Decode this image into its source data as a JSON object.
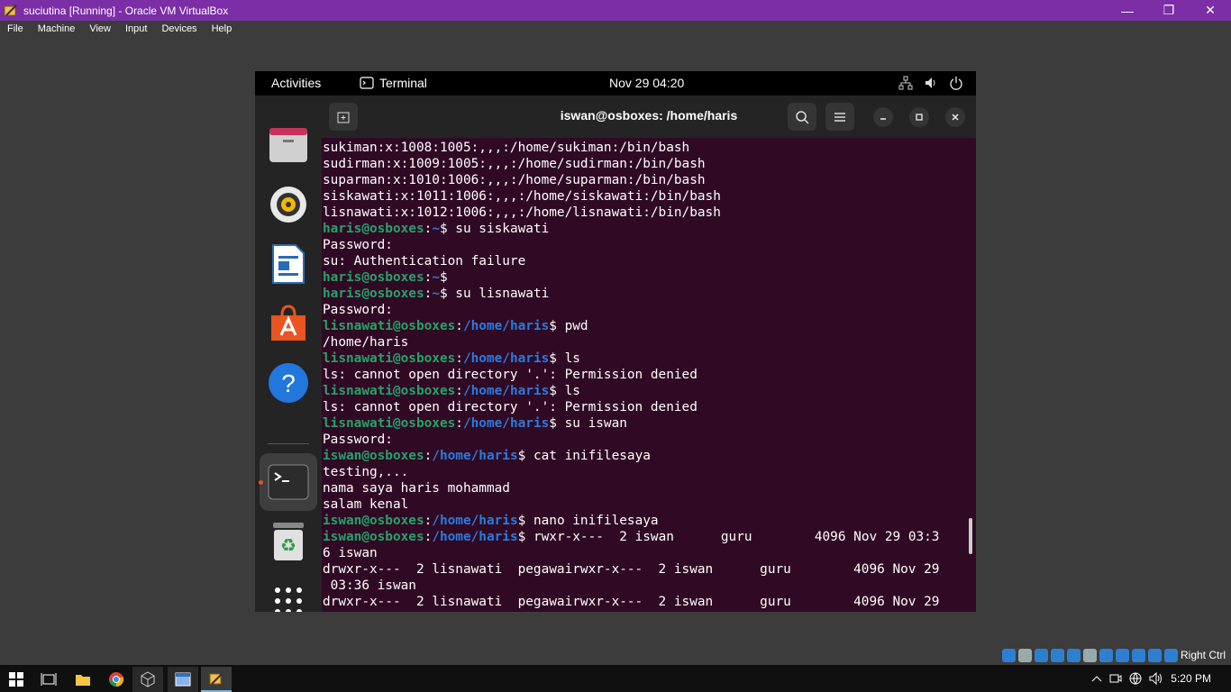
{
  "window": {
    "title": "suciutina [Running] - Oracle VM VirtualBox",
    "minimize": "—",
    "restore": "❐",
    "close": "✕"
  },
  "menu": [
    "File",
    "Machine",
    "View",
    "Input",
    "Devices",
    "Help"
  ],
  "gnome": {
    "activities": "Activities",
    "app_name": "Terminal",
    "clock": "Nov 29  04:20"
  },
  "terminal": {
    "title": "iswan@osboxes: /home/haris",
    "lines": [
      [
        [
          "t",
          "sukiman:x:1008:1005:,,,:/home/sukiman:/bin/bash"
        ]
      ],
      [
        [
          "t",
          "sudirman:x:1009:1005:,,,:/home/sudirman:/bin/bash"
        ]
      ],
      [
        [
          "t",
          "suparman:x:1010:1006:,,,:/home/suparman:/bin/bash"
        ]
      ],
      [
        [
          "t",
          "siskawati:x:1011:1006:,,,:/home/siskawati:/bin/bash"
        ]
      ],
      [
        [
          "t",
          "lisnawati:x:1012:1006:,,,:/home/lisnawati:/bin/bash"
        ]
      ],
      [
        [
          "u",
          "haris@osboxes"
        ],
        [
          "t",
          ":"
        ],
        [
          "p",
          "~"
        ],
        [
          "t",
          "$ su siskawati"
        ]
      ],
      [
        [
          "t",
          "Password:"
        ]
      ],
      [
        [
          "t",
          "su: Authentication failure"
        ]
      ],
      [
        [
          "u",
          "haris@osboxes"
        ],
        [
          "t",
          ":"
        ],
        [
          "p",
          "~"
        ],
        [
          "t",
          "$"
        ]
      ],
      [
        [
          "u",
          "haris@osboxes"
        ],
        [
          "t",
          ":"
        ],
        [
          "p",
          "~"
        ],
        [
          "t",
          "$ su lisnawati"
        ]
      ],
      [
        [
          "t",
          "Password:"
        ]
      ],
      [
        [
          "u",
          "lisnawati@osboxes"
        ],
        [
          "t",
          ":"
        ],
        [
          "p",
          "/home/haris"
        ],
        [
          "t",
          "$ pwd"
        ]
      ],
      [
        [
          "t",
          "/home/haris"
        ]
      ],
      [
        [
          "u",
          "lisnawati@osboxes"
        ],
        [
          "t",
          ":"
        ],
        [
          "p",
          "/home/haris"
        ],
        [
          "t",
          "$ ls"
        ]
      ],
      [
        [
          "t",
          "ls: cannot open directory '.': Permission denied"
        ]
      ],
      [
        [
          "u",
          "lisnawati@osboxes"
        ],
        [
          "t",
          ":"
        ],
        [
          "p",
          "/home/haris"
        ],
        [
          "t",
          "$ ls"
        ]
      ],
      [
        [
          "t",
          "ls: cannot open directory '.': Permission denied"
        ]
      ],
      [
        [
          "u",
          "lisnawati@osboxes"
        ],
        [
          "t",
          ":"
        ],
        [
          "p",
          "/home/haris"
        ],
        [
          "t",
          "$ su iswan"
        ]
      ],
      [
        [
          "t",
          "Password:"
        ]
      ],
      [
        [
          "u",
          "iswan@osboxes"
        ],
        [
          "t",
          ":"
        ],
        [
          "p",
          "/home/haris"
        ],
        [
          "t",
          "$ cat inifilesaya"
        ]
      ],
      [
        [
          "t",
          "testing,..."
        ]
      ],
      [
        [
          "t",
          "nama saya haris mohammad"
        ]
      ],
      [
        [
          "t",
          "salam kenal"
        ]
      ],
      [
        [
          "u",
          "iswan@osboxes"
        ],
        [
          "t",
          ":"
        ],
        [
          "p",
          "/home/haris"
        ],
        [
          "t",
          "$ nano inifilesaya"
        ]
      ],
      [
        [
          "u",
          "iswan@osboxes"
        ],
        [
          "t",
          ":"
        ],
        [
          "p",
          "/home/haris"
        ],
        [
          "t",
          "$ rwxr-x---  2 iswan      guru        4096 Nov 29 03:3"
        ]
      ],
      [
        [
          "t",
          "6 iswan"
        ]
      ],
      [
        [
          "t",
          "drwxr-x---  2 lisnawati  pegawairwxr-x---  2 iswan      guru        4096 Nov 29"
        ]
      ],
      [
        [
          "t",
          " 03:36 iswan"
        ]
      ],
      [
        [
          "t",
          "drwxr-x---  2 lisnawati  pegawairwxr-x---  2 iswan      guru        4096 Nov 29"
        ]
      ]
    ]
  },
  "host_status": {
    "right_ctrl": "Right Ctrl"
  },
  "taskbar": {
    "time": "5:20 PM"
  }
}
